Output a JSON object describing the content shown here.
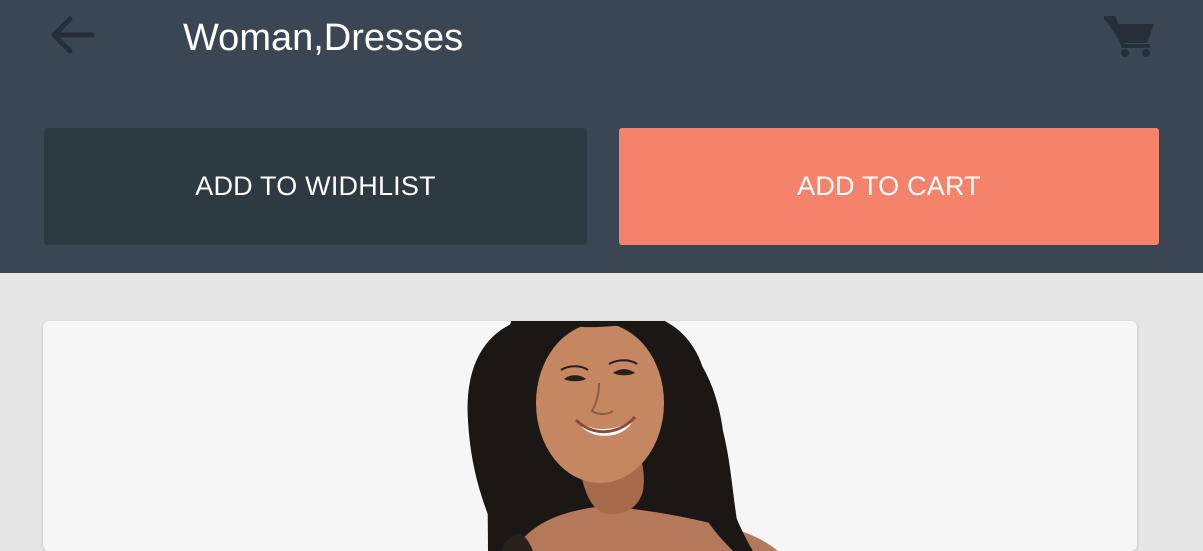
{
  "header": {
    "title": "Woman,Dresses",
    "back_icon": "arrow-left-icon",
    "cart_icon": "shopping-cart-icon",
    "background_color": "#3a4653"
  },
  "actions": {
    "wishlist_label": "ADD TO WIDHLIST",
    "cart_label": "ADD TO CART",
    "wishlist_color": "#2e3a42",
    "cart_color": "#f5836b"
  },
  "product": {
    "image": "product-photo-woman-in-dress"
  }
}
